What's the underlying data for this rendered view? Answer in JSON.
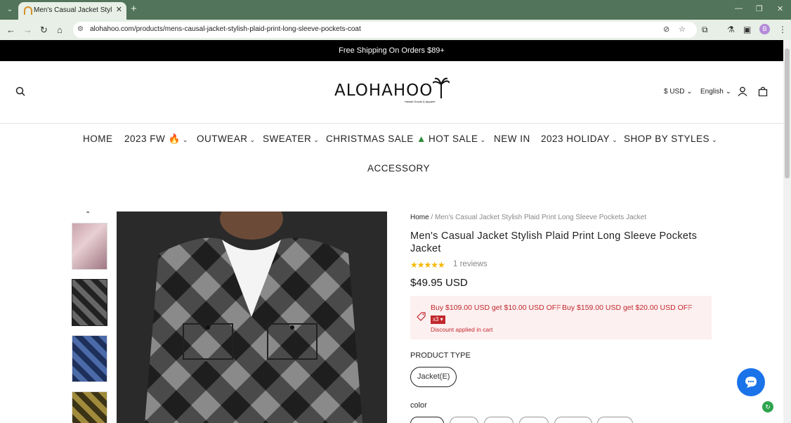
{
  "browser": {
    "tab_title": "Men's Casual Jacket Stylish Plaid",
    "url": "alohahoo.com/products/mens-causal-jacket-stylish-plaid-print-long-sleeve-pockets-coat",
    "profile_initial": "B"
  },
  "announcement": "Free Shipping On Orders $89+",
  "header": {
    "logo_text": "ALOHAHOO",
    "logo_tagline": "Hawaii Goods & Apparel",
    "currency": "$ USD",
    "language": "English"
  },
  "menu": {
    "home": "HOME",
    "fw": "2023 FW",
    "outwear": "OUTWEAR",
    "sweater": "SWEATER",
    "christmas": "CHRISTMAS SALE",
    "hot": "HOT SALE",
    "newin": "NEW IN",
    "holiday": "2023 HOLIDAY",
    "styles": "SHOP BY STYLES",
    "accessory": "ACCESSORY"
  },
  "product": {
    "breadcrumb_home": "Home",
    "breadcrumb_sep": "/",
    "breadcrumb_current": "Men's Casual Jacket Stylish Plaid Print Long Sleeve Pockets Jacket",
    "title": "Men's Casual Jacket Stylish Plaid Print Long Sleeve Pockets Jacket",
    "rating": 5,
    "stars": "★★★★★",
    "reviews": "1 reviews",
    "price": "$49.95 USD",
    "promo": {
      "offer1": "Buy $109.00 USD get $10.00 USD OFF",
      "offer2": "Buy $159.00 USD get $20.00 USD OFF",
      "badge": "x3 ▾",
      "note": "Discount applied in cart"
    },
    "product_type_label": "PRODUCT TYPE",
    "product_type_option": "Jacket(E)",
    "color_label": "color"
  },
  "colors": {
    "accent_red": "#c1272d",
    "chat_blue": "#1a73e8",
    "chrome_green": "#52745a"
  }
}
